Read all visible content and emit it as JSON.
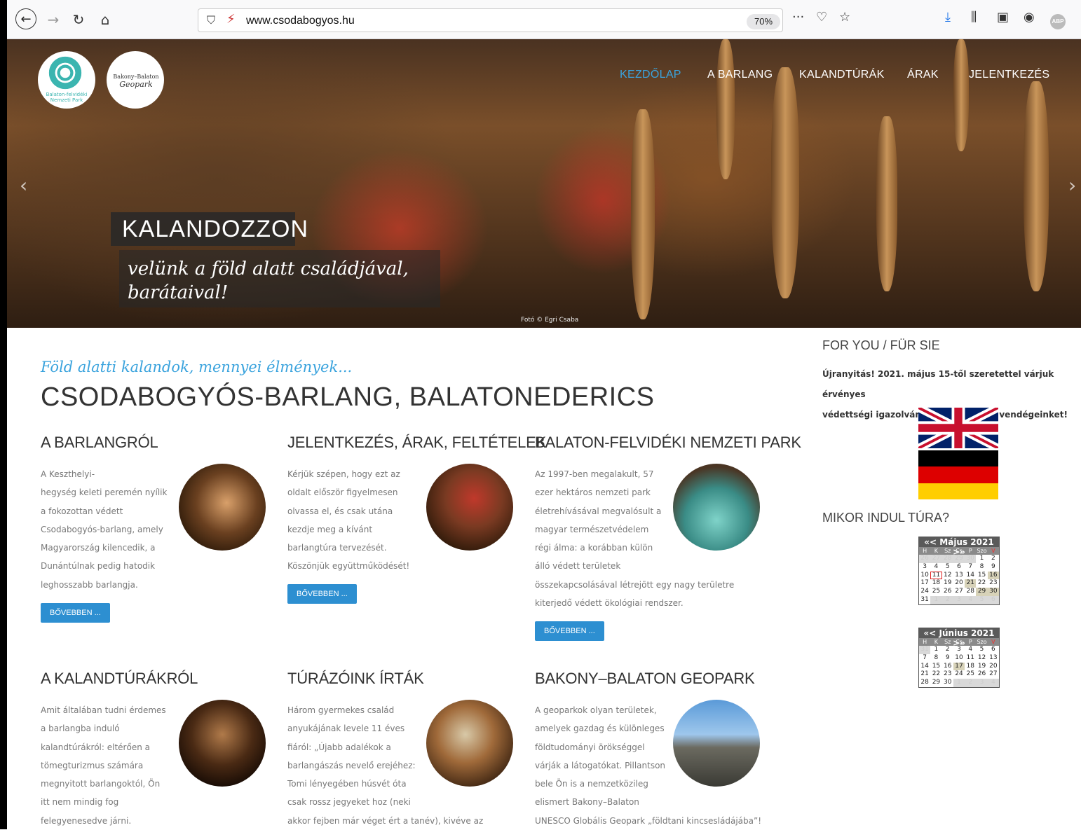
{
  "browser": {
    "url": "www.csodabogyos.hu",
    "zoom": "70%",
    "abp": "ABP"
  },
  "site": {
    "logo1_text": "Balaton-felvidéki Nemzeti Park",
    "logo2_line1": "Bakony–Balaton",
    "logo2_line2": "Geopark",
    "nav": [
      "KEZDŐLAP",
      "A BARLANG",
      "KALANDTÚRÁK",
      "ÁRAK",
      "JELENTKEZÉS"
    ],
    "active_nav": "KEZDŐLAP"
  },
  "hero": {
    "caption1": "KALANDOZZON",
    "caption2_line1": "velünk a föld alatt családjával,",
    "caption2_line2": "barátaival!",
    "photo_credit": "Fotó © Egri Csaba"
  },
  "main": {
    "tagline": "Föld alatti kalandok, mennyei élmények...",
    "title": "CSODABOGYÓS-BARLANG, BALATONEDERICS",
    "sections": [
      {
        "title": "A BARLANGRÓL",
        "lines": [
          "A Keszthelyi-",
          "hegység keleti peremén nyílik",
          "a fokozottan védett",
          "Csodabogyós-barlang, amely",
          "Magyarország kilencedik, a",
          "Dunántúlnak pedig hatodik",
          "leghosszabb barlangja."
        ],
        "button": "BŐVEBBEN ..."
      },
      {
        "title": "JELENTKEZÉS, ÁRAK, FELTÉTELEK",
        "lines": [
          "Kérjük szépen, hogy ezt az",
          "oldalt először figyelmesen",
          "olvassa el, és csak utána",
          "kezdje meg a kívánt",
          "barlangtúra tervezését.",
          "Köszönjük együttműködését!"
        ],
        "button": "BŐVEBBEN ..."
      },
      {
        "title": "BALATON-FELVIDÉKI NEMZETI PARK",
        "lines": [
          "Az 1997-ben megalakult, 57",
          "ezer hektáros nemzeti park",
          "életrehívásával megvalósult a",
          "magyar természetvédelem",
          "régi álma: a korábban külön",
          "álló védett területek",
          "összekapcsolásával létrejött egy nagy területre",
          "kiterjedő védett ökológiai rendszer."
        ],
        "button": "BŐVEBBEN ..."
      },
      {
        "title": "A KALANDTÚRÁKRÓL",
        "lines": [
          "Amit általában tudni érdemes",
          "a barlangba induló",
          "kalandtúrákról: eltérően a",
          "tömegturizmus számára",
          "megnyitott barlangoktól, Ön",
          "itt nem mindig fog",
          "felegyenesedve járni."
        ]
      },
      {
        "title": "TÚRÁZÓINK ÍRTÁK",
        "lines": [
          "Három gyermekes család",
          "anyukájának levele 11 éves",
          "fiáról: „Újabb adalékok a",
          "barlangászás nevelő erejéhez:",
          "Tomi lényegében húsvét óta",
          "csak rossz jegyeket hoz (neki",
          "akkor fejben már véget ért a tanév), kivéve az"
        ]
      },
      {
        "title": "BAKONY–BALATON GEOPARK",
        "lines": [
          "A geoparkok olyan területek,",
          "amelyek gazdag és különleges",
          "földtudományi örökséggel",
          "várják a látogatókat. Pillantson",
          "bele Ön is a nemzetközileg",
          "elismert Bakony–Balaton",
          "UNESCO Globális Geopark „földtani kincsesládájába”!"
        ]
      }
    ]
  },
  "sidebar": {
    "heading1": "FOR YOU / FÜR SIE",
    "notice_line1": "Újranyitás! 2021. május 15-től szeretettel várjuk érvényes",
    "notice_line2": "védettségi igazolvánnyal rendelkező vendégeinket!",
    "heading2": "MIKOR INDUL TÚRA?",
    "cal1_title": "«< Május 2021 >»",
    "cal2_title": "«< Június 2021 >»",
    "dow": [
      "H",
      "K",
      "Sz",
      "Cs",
      "P",
      "Szo",
      "V"
    ]
  },
  "colors": {
    "accent": "#3aa3dd",
    "button": "#2d8fd1"
  }
}
